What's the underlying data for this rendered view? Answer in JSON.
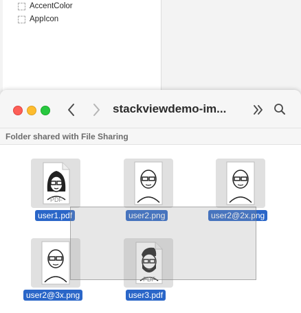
{
  "background_list": {
    "items": [
      {
        "label": "AccentColor"
      },
      {
        "label": "AppIcon"
      }
    ]
  },
  "window": {
    "title": "stackviewdemo-im...",
    "section_header": "Folder shared with File Sharing"
  },
  "files": [
    {
      "name": "user1.pdf",
      "kind": "pdf",
      "badge": "PDF"
    },
    {
      "name": "user2.png",
      "kind": "png"
    },
    {
      "name": "user2@2x.png",
      "kind": "png"
    },
    {
      "name": "user2@3x.png",
      "kind": "png"
    },
    {
      "name": "user3.pdf",
      "kind": "pdf",
      "badge": "PDF"
    }
  ],
  "colors": {
    "selection_label": "#2a66c8",
    "close": "#fd5f57",
    "minimize": "#febc2e",
    "zoom": "#28c840"
  }
}
